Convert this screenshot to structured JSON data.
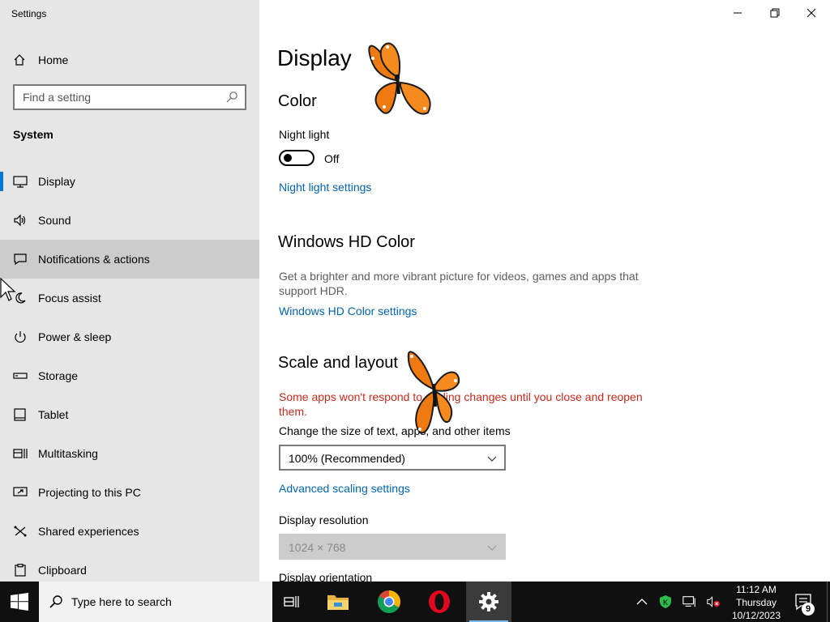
{
  "window": {
    "title": "Settings"
  },
  "sidebar": {
    "home_label": "Home",
    "search_placeholder": "Find a setting",
    "section_heading": "System",
    "items": [
      {
        "label": "Display",
        "icon": "monitor-icon"
      },
      {
        "label": "Sound",
        "icon": "speaker-icon"
      },
      {
        "label": "Notifications & actions",
        "icon": "notification-icon"
      },
      {
        "label": "Focus assist",
        "icon": "moon-icon"
      },
      {
        "label": "Power & sleep",
        "icon": "power-icon"
      },
      {
        "label": "Storage",
        "icon": "storage-icon"
      },
      {
        "label": "Tablet",
        "icon": "tablet-icon"
      },
      {
        "label": "Multitasking",
        "icon": "multitasking-icon"
      },
      {
        "label": "Projecting to this PC",
        "icon": "projecting-icon"
      },
      {
        "label": "Shared experiences",
        "icon": "shared-experiences-icon"
      },
      {
        "label": "Clipboard",
        "icon": "clipboard-icon"
      }
    ]
  },
  "main": {
    "page_title": "Display",
    "color": {
      "heading": "Color",
      "night_light_label": "Night light",
      "night_light_state": "Off",
      "night_light_link": "Night light settings"
    },
    "hdr": {
      "heading": "Windows HD Color",
      "description": "Get a brighter and more vibrant picture for videos, games and apps that support HDR.",
      "link": "Windows HD Color settings"
    },
    "scale": {
      "heading": "Scale and layout",
      "warning": "Some apps won't respond to scaling changes until you close and reopen them.",
      "size_label": "Change the size of text, apps, and other items",
      "size_value": "100% (Recommended)",
      "advanced_link": "Advanced scaling settings",
      "resolution_label": "Display resolution",
      "resolution_value": "1024 × 768",
      "orientation_label": "Display orientation"
    }
  },
  "taskbar": {
    "search_placeholder": "Type here to search",
    "apps": [
      "task-view",
      "file-explorer",
      "chrome",
      "opera",
      "settings"
    ],
    "clock": {
      "time": "11:12 AM",
      "day": "Thursday",
      "date": "10/12/2023"
    },
    "notification_count": "9"
  },
  "colors": {
    "accent": "#0078d7",
    "link": "#0063b1",
    "warning": "#c42b1c",
    "sidebar_bg": "#e6e6e6",
    "taskbar_bg": "#101010"
  }
}
